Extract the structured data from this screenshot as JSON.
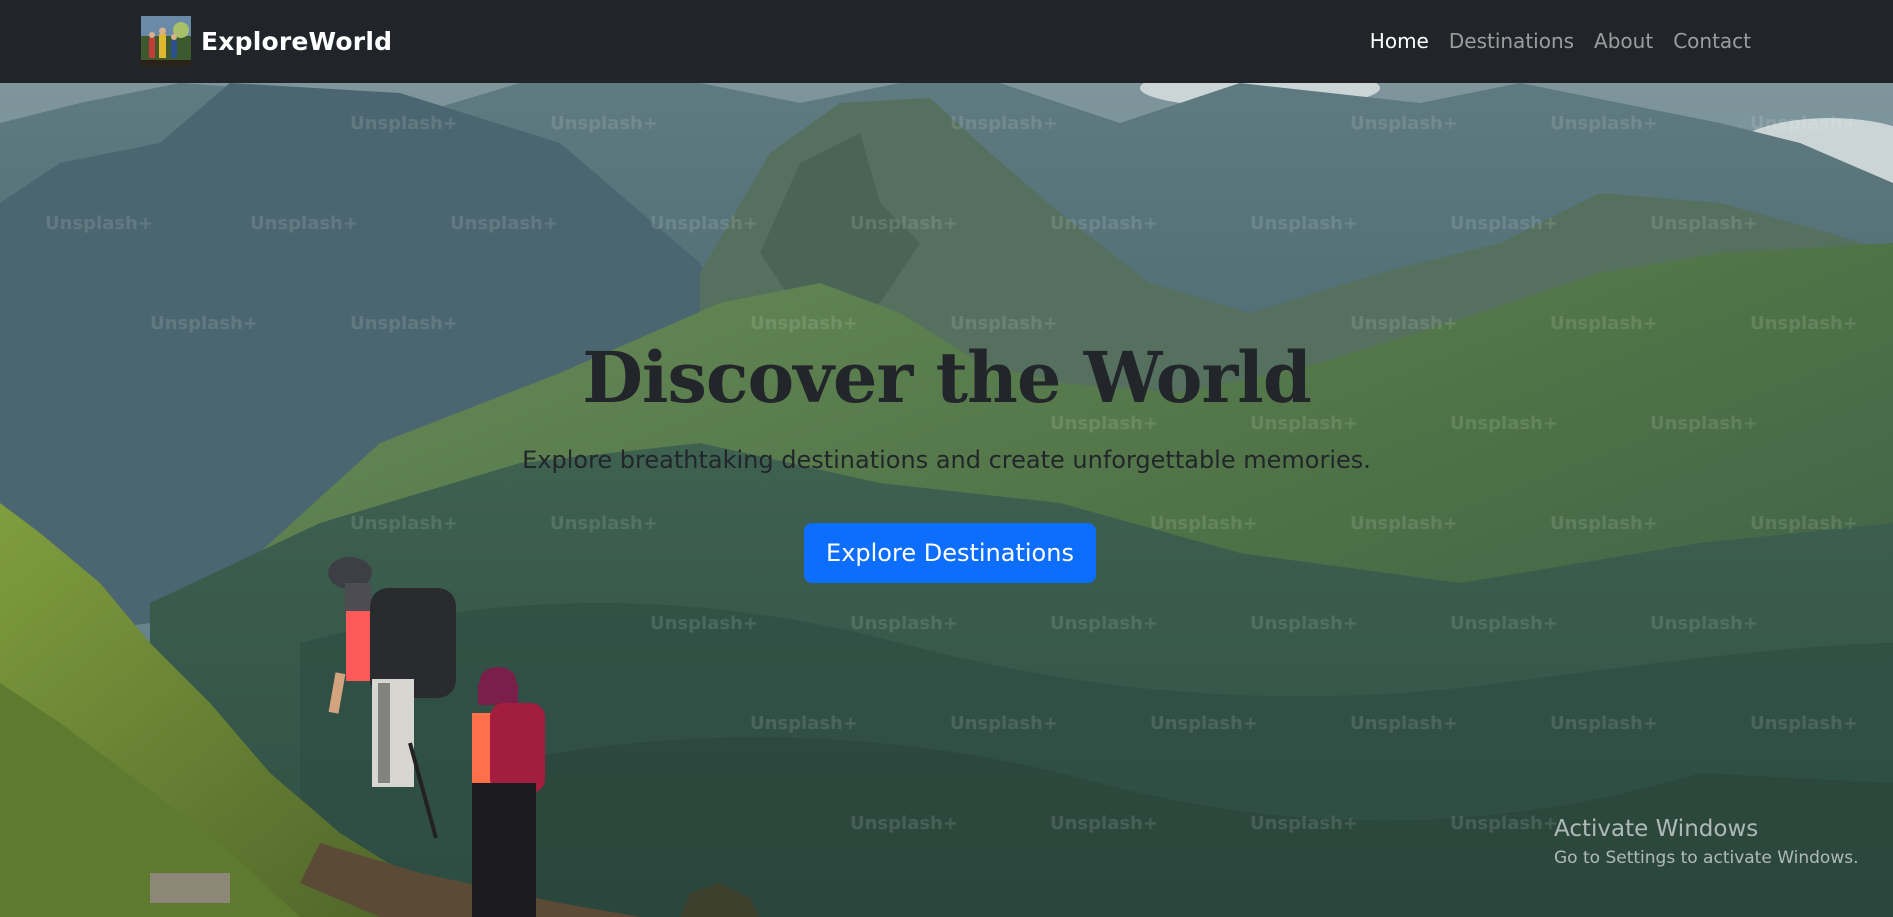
{
  "navbar": {
    "brand_name": "ExploreWorld",
    "links": [
      {
        "label": "Home",
        "active": true
      },
      {
        "label": "Destinations",
        "active": false
      },
      {
        "label": "About",
        "active": false
      },
      {
        "label": "Contact",
        "active": false
      }
    ]
  },
  "hero": {
    "title": "Discover the World",
    "subtitle": "Explore breathtaking destinations and create unforgettable memories.",
    "cta_label": "Explore Destinations",
    "watermark_text": "Unsplash+"
  },
  "windows_overlay": {
    "title": "Activate Windows",
    "subtitle": "Go to Settings to activate Windows."
  },
  "colors": {
    "navbar_bg": "#212529",
    "nav_active": "#ffffff",
    "nav_inactive": "#9a9da0",
    "cta_bg": "#0d6efd",
    "heading_text": "#22262a"
  },
  "icons": {
    "brand_logo": "hikers-photo-logo"
  }
}
